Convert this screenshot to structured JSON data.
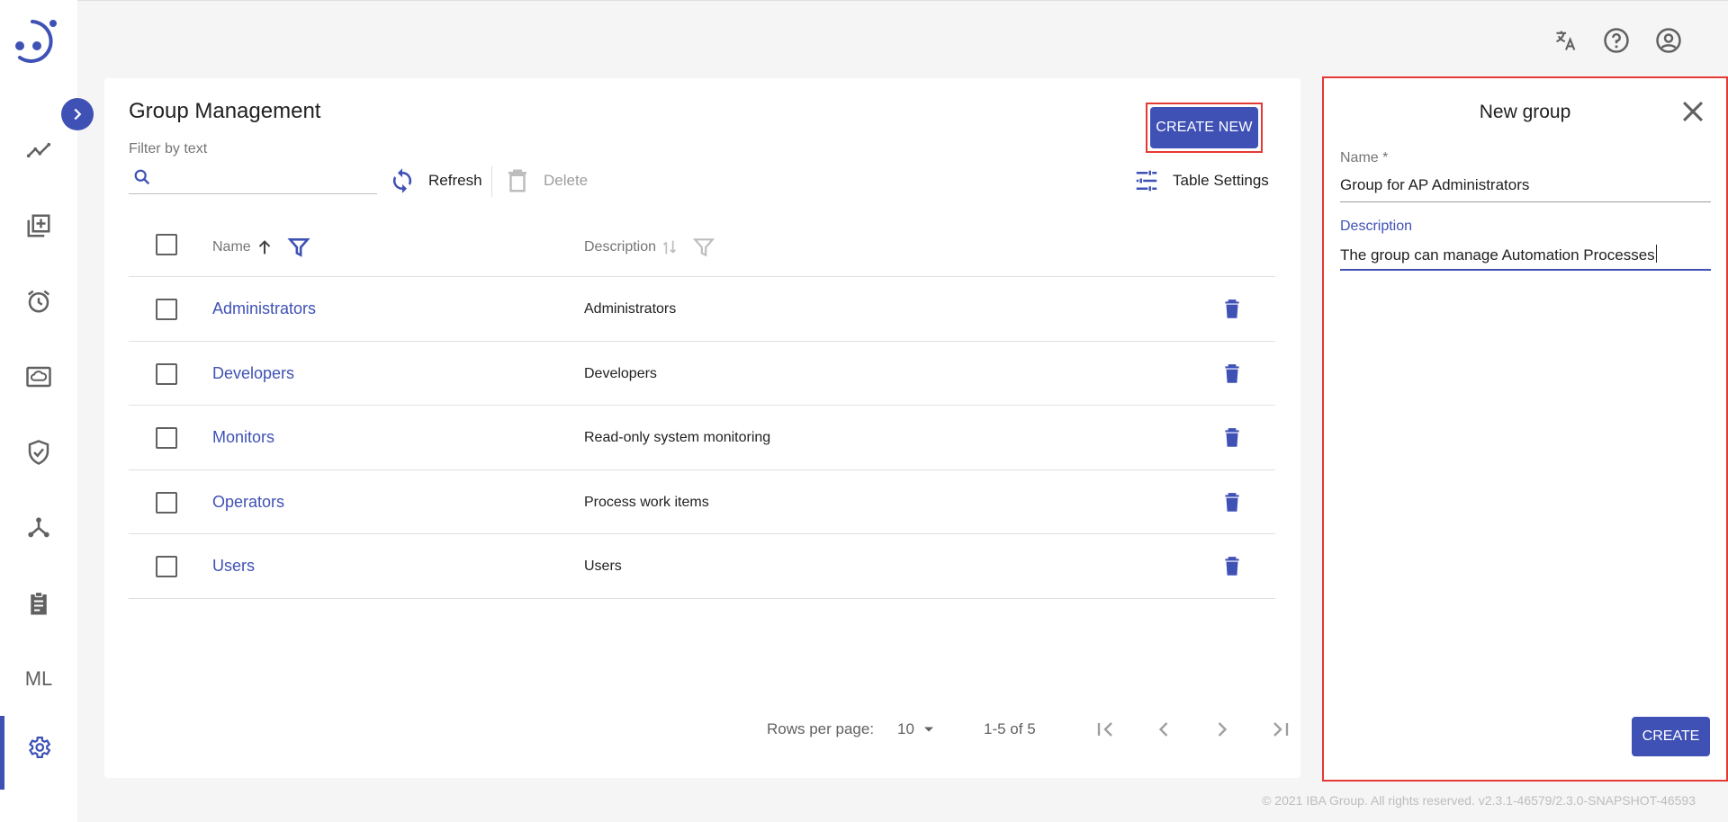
{
  "app": {
    "logo_icon": "app-logo-icon"
  },
  "sidebar": {
    "expand_icon": "chevron-right-icon",
    "items": [
      {
        "icon": "trend-icon",
        "label": ""
      },
      {
        "icon": "add-library-icon",
        "label": ""
      },
      {
        "icon": "alarm-icon",
        "label": ""
      },
      {
        "icon": "cloud-screen-icon",
        "label": ""
      },
      {
        "icon": "shield-check-icon",
        "label": ""
      },
      {
        "icon": "hub-icon",
        "label": ""
      },
      {
        "icon": "clipboard-icon",
        "label": ""
      },
      {
        "icon": "ml-text-icon",
        "label": "ML"
      },
      {
        "icon": "gear-icon",
        "label": "",
        "active": true
      }
    ]
  },
  "topbar": {
    "translate_icon": "translate-icon",
    "help_icon": "help-icon",
    "account_icon": "account-circle-icon"
  },
  "main": {
    "title": "Group Management",
    "create_new_label": "CREATE NEW",
    "filter_label": "Filter by text",
    "filter_value": "",
    "refresh_label": "Refresh",
    "delete_label": "Delete",
    "table_settings_label": "Table Settings",
    "table": {
      "columns": [
        "Name",
        "Description"
      ],
      "rows": [
        {
          "name": "Administrators",
          "description": "Administrators"
        },
        {
          "name": "Developers",
          "description": "Developers"
        },
        {
          "name": "Monitors",
          "description": "Read-only system monitoring"
        },
        {
          "name": "Operators",
          "description": "Process work items"
        },
        {
          "name": "Users",
          "description": "Users"
        }
      ]
    },
    "pagination": {
      "rows_per_page_label": "Rows per page:",
      "rows_per_page_value": "10",
      "range": "1-5 of 5"
    }
  },
  "footer": {
    "text": "© 2021 IBA Group. All rights reserved. v2.3.1-46579/2.3.0-SNAPSHOT-46593"
  },
  "panel": {
    "title": "New group",
    "name_label": "Name *",
    "name_value": "Group for AP Administrators",
    "description_label": "Description",
    "description_value": "The group can manage Automation Processes",
    "create_label": "CREATE"
  },
  "colors": {
    "primary": "#3f51b5",
    "highlight_border": "#e53935"
  }
}
